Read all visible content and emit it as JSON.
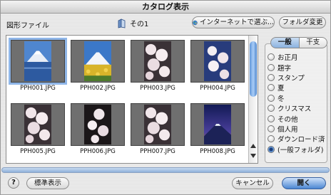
{
  "window": {
    "title": "カタログ表示"
  },
  "header": {
    "folder_label": "図形ファイル",
    "current_folder": "その1",
    "internet_button": "インターネットで選ぶ...",
    "folder_change_button": "フォルダ変更"
  },
  "thumbnails": [
    {
      "caption": "PPH001.JPG",
      "selected": true,
      "subject": "mount-fuji-lake"
    },
    {
      "caption": "PPH002.JPG",
      "selected": false,
      "subject": "mount-fuji-flowers"
    },
    {
      "caption": "PPH003.JPG",
      "selected": false,
      "subject": "cherry-blossoms"
    },
    {
      "caption": "PPH004.JPG",
      "selected": false,
      "subject": "cherry-blossoms-blue-sky"
    },
    {
      "caption": "PPH005.JPG",
      "selected": false,
      "subject": "cherry-blossoms"
    },
    {
      "caption": "PPH006.JPG",
      "selected": false,
      "subject": "cherry-blossoms-dark"
    },
    {
      "caption": "PPH007.JPG",
      "selected": false,
      "subject": "cherry-blossoms"
    },
    {
      "caption": "PPH008.JPG",
      "selected": false,
      "subject": "mount-fuji-dusk"
    }
  ],
  "tabs": [
    {
      "label": "一般",
      "active": true
    },
    {
      "label": "干支",
      "active": false
    }
  ],
  "categories": [
    {
      "label": "お正月",
      "checked": false
    },
    {
      "label": "題字",
      "checked": false
    },
    {
      "label": "スタンプ",
      "checked": false
    },
    {
      "label": "夏",
      "checked": false
    },
    {
      "label": "冬",
      "checked": false
    },
    {
      "label": "クリスマス",
      "checked": false
    },
    {
      "label": "その他",
      "checked": false
    },
    {
      "label": "個人用",
      "checked": false
    },
    {
      "label": "ダウンロード済",
      "checked": false
    },
    {
      "label": "(一般フォルダ)",
      "checked": true
    }
  ],
  "footer": {
    "help_label": "?",
    "standard_view_button": "標準表示",
    "cancel_button": "キャンセル",
    "open_button": "開く"
  },
  "colors": {
    "accent": "#5f95d8",
    "selection": "#8fb6e8",
    "scroll_thumb": "#5f95d8"
  }
}
